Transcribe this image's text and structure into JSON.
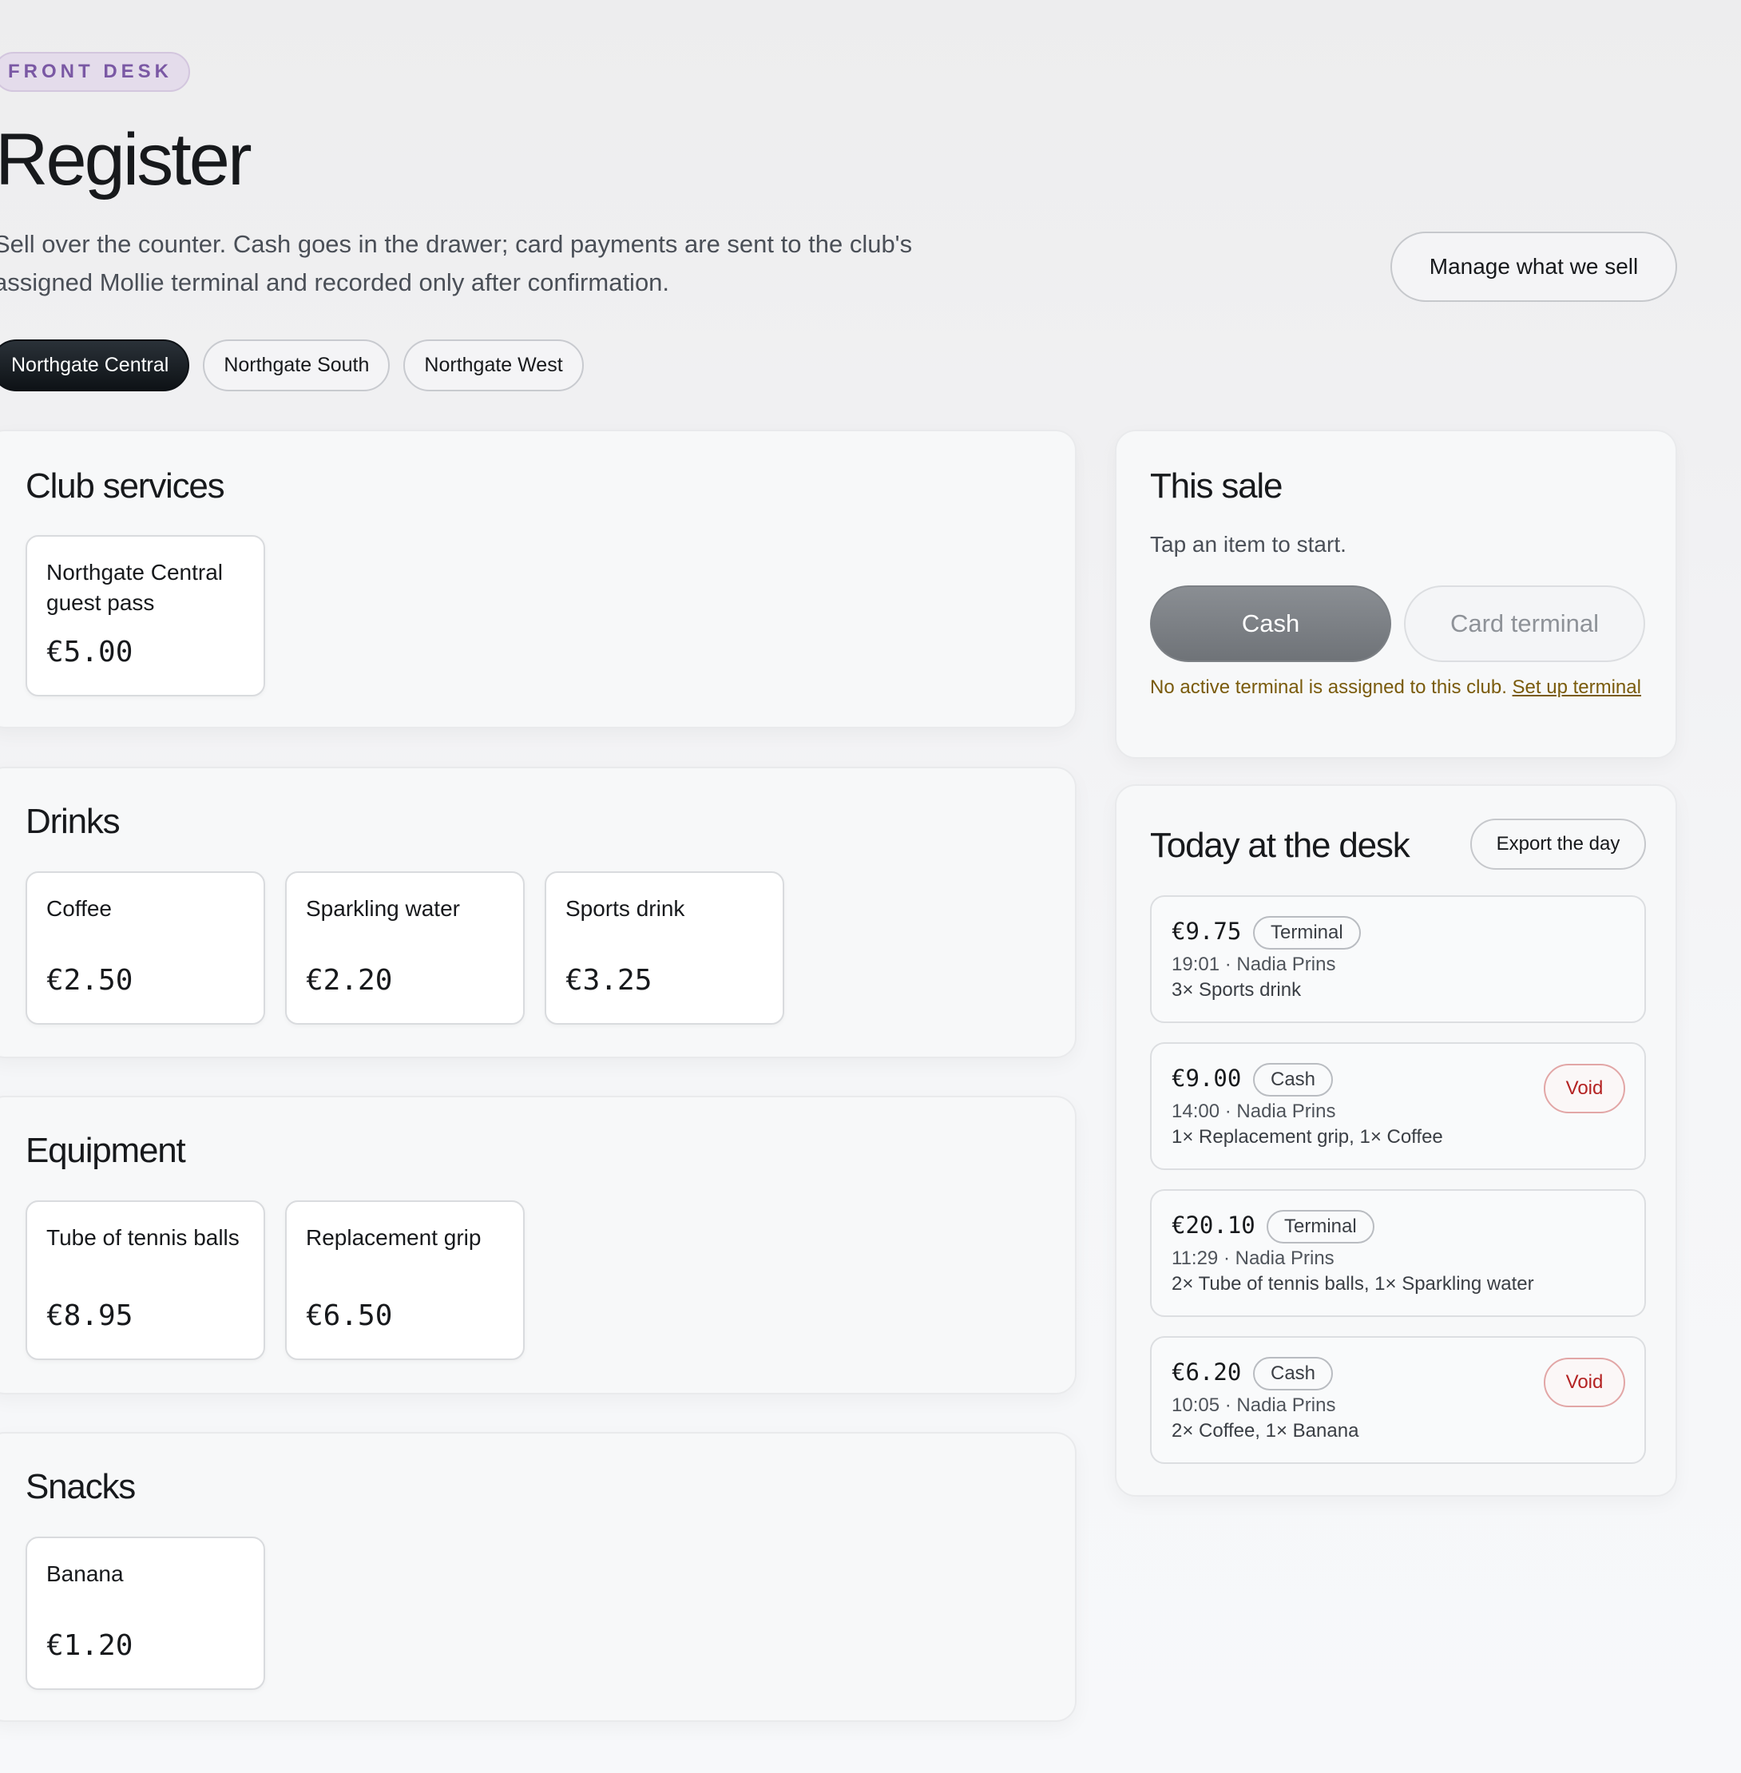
{
  "header": {
    "eyebrow": "FRONT DESK",
    "title": "Register",
    "intro": "Sell over the counter. Cash goes in the drawer; card payments are sent to the club's assigned Mollie terminal and recorded only after confirmation.",
    "manage_label": "Manage what we sell"
  },
  "clubs": {
    "active": "Northgate Central",
    "items": [
      "Northgate Central",
      "Northgate South",
      "Northgate West"
    ]
  },
  "catalog": [
    {
      "title": "Club services",
      "products": [
        {
          "name": "Northgate Central guest pass",
          "price": "€5.00"
        }
      ]
    },
    {
      "title": "Drinks",
      "products": [
        {
          "name": "Coffee",
          "price": "€2.50"
        },
        {
          "name": "Sparkling water",
          "price": "€2.20"
        },
        {
          "name": "Sports drink",
          "price": "€3.25"
        }
      ]
    },
    {
      "title": "Equipment",
      "products": [
        {
          "name": "Tube of tennis balls",
          "price": "€8.95"
        },
        {
          "name": "Replacement grip",
          "price": "€6.50"
        }
      ]
    },
    {
      "title": "Snacks",
      "products": [
        {
          "name": "Banana",
          "price": "€1.20"
        }
      ]
    }
  ],
  "sale": {
    "title": "This sale",
    "hint": "Tap an item to start.",
    "cash_label": "Cash",
    "card_label": "Card terminal",
    "terminal_note": "No active terminal is assigned to this club.",
    "setup_link": "Set up terminal"
  },
  "today": {
    "title": "Today at the desk",
    "export_label": "Export the day",
    "transactions": [
      {
        "amount": "€9.75",
        "method": "Terminal",
        "meta": "19:01 · Nadia Prins",
        "items": "3× Sports drink",
        "void": ""
      },
      {
        "amount": "€9.00",
        "method": "Cash",
        "meta": "14:00 · Nadia Prins",
        "items": "1× Replacement grip, 1× Coffee",
        "void": "Void"
      },
      {
        "amount": "€20.10",
        "method": "Terminal",
        "meta": "11:29 · Nadia Prins",
        "items": "2× Tube of tennis balls, 1× Sparkling water",
        "void": ""
      },
      {
        "amount": "€6.20",
        "method": "Cash",
        "meta": "10:05 · Nadia Prins",
        "items": "2× Coffee, 1× Banana",
        "void": "Void"
      }
    ]
  },
  "colors": {
    "accent_dark": "#0e1216",
    "eyebrow_bg": "#e4dceb",
    "eyebrow_text": "#7a58a4",
    "warning_text": "#7a5b0c",
    "void_red": "#b42323"
  }
}
